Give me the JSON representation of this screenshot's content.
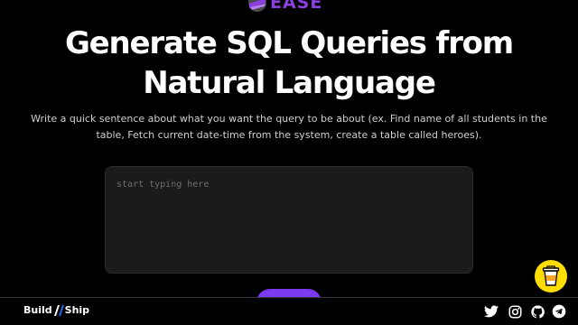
{
  "brand": {
    "logo_text": "EASE",
    "accent_color": "#8b3fe0"
  },
  "hero": {
    "title_line1": "Generate SQL Queries from",
    "title_line2": "Natural Language",
    "description": "Write a quick sentence about what you want the query to be about (ex. Find name of all students in the table, Fetch current date-time from the system, create a table called heroes)."
  },
  "query_input": {
    "value": "",
    "placeholder": "start typing here"
  },
  "generate_button": {
    "color": "#7c3aed"
  },
  "coffee_widget": {
    "icon": "coffee-cup-icon",
    "color": "#ffdd00"
  },
  "footer": {
    "brand_part1": "Build",
    "brand_part2": "Ship",
    "brand_accent_color": "#2563eb",
    "social_icons": [
      "twitter-icon",
      "instagram-icon",
      "github-icon",
      "telegram-icon"
    ]
  }
}
